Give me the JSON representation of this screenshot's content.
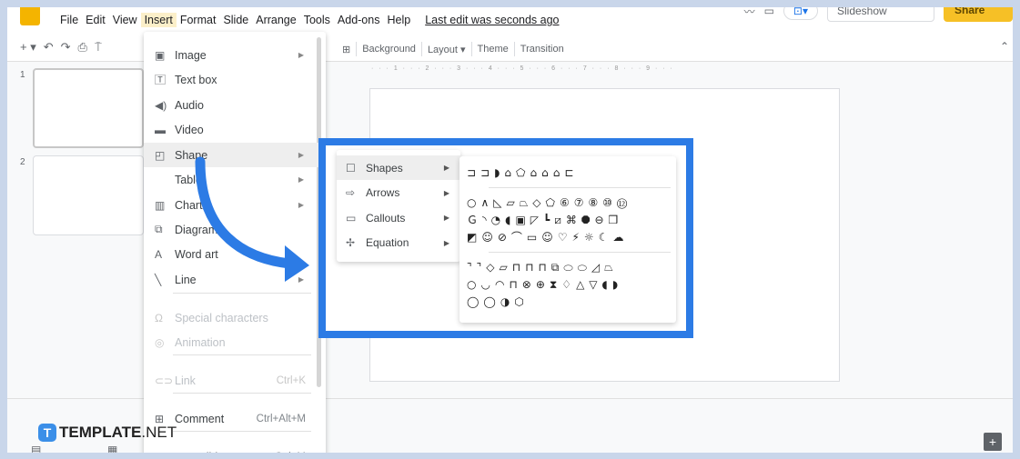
{
  "menubar": {
    "items": [
      "File",
      "Edit",
      "View",
      "Insert",
      "Format",
      "Slide",
      "Arrange",
      "Tools",
      "Add-ons",
      "Help"
    ],
    "active": "Insert",
    "last_edit": "Last edit was seconds ago"
  },
  "header": {
    "slideshow_label": "Slideshow",
    "share_label": "Share"
  },
  "toolbar": {
    "background": "Background",
    "layout": "Layout ▾",
    "theme": "Theme",
    "transition": "Transition"
  },
  "ruler": "· · · 1 · · · 2 · · · 3 · · · 4 · · · 5 · · · 6 · · · 7 · · · 8 · · · 9 · · ·",
  "filmstrip": {
    "slides": [
      "1",
      "2"
    ]
  },
  "insert_menu": {
    "items": [
      {
        "label": "Image",
        "icon": "image-icon",
        "submenu": true
      },
      {
        "label": "Text box",
        "icon": "textbox-icon"
      },
      {
        "label": "Audio",
        "icon": "audio-icon"
      },
      {
        "label": "Video",
        "icon": "video-icon"
      },
      {
        "label": "Shape",
        "icon": "shape-icon",
        "submenu": true,
        "highlighted": true
      },
      {
        "label": "Table",
        "icon": "table-icon",
        "submenu": true
      },
      {
        "label": "Chart",
        "icon": "chart-icon",
        "submenu": true
      },
      {
        "label": "Diagram",
        "icon": "diagram-icon"
      },
      {
        "label": "Word art",
        "icon": "wordart-icon"
      },
      {
        "label": "Line",
        "icon": "line-icon",
        "submenu": true
      },
      {
        "label": "Special characters",
        "icon": "omega-icon",
        "disabled": true
      },
      {
        "label": "Animation",
        "icon": "animation-icon",
        "disabled": true
      },
      {
        "label": "Link",
        "icon": "link-icon",
        "shortcut": "Ctrl+K",
        "disabled": true
      },
      {
        "label": "Comment",
        "icon": "comment-icon",
        "shortcut": "Ctrl+Alt+M"
      },
      {
        "label": "New slide",
        "icon": "plus-icon",
        "shortcut": "Ctrl+M"
      }
    ]
  },
  "shape_submenu": {
    "items": [
      {
        "label": "Shapes",
        "icon": "square-icon",
        "highlighted": true
      },
      {
        "label": "Arrows",
        "icon": "arrow-icon"
      },
      {
        "label": "Callouts",
        "icon": "callout-icon"
      },
      {
        "label": "Equation",
        "icon": "equation-plus-icon"
      }
    ]
  },
  "shapes_panel": {
    "rows": [
      "⊐⊐◗⌂⬠⌂⌂⌂⊏",
      "○∧◺▱⏢◇⬠⑥⑦⑧⑩⑫",
      "Ｇ◝◔◖▣◸┗⧄⌘⯃⊖❒",
      "◩☺⊘⌒▭☺♡⚡☼☾☁",
      "⌝⌝◇▱⊓⊓⊓⧉⬭⬭◿⏢",
      "○◡◠⊓⊗⊕⧗♢△▽◖◗",
      "◯◯◑⬡"
    ]
  },
  "watermark": {
    "brand": "TEMPLATE",
    "tld": ".NET",
    "letter": "T"
  },
  "colors": {
    "accent_box": "#2c7be5",
    "share": "#f6c026",
    "highlight": "#fbefc9"
  }
}
